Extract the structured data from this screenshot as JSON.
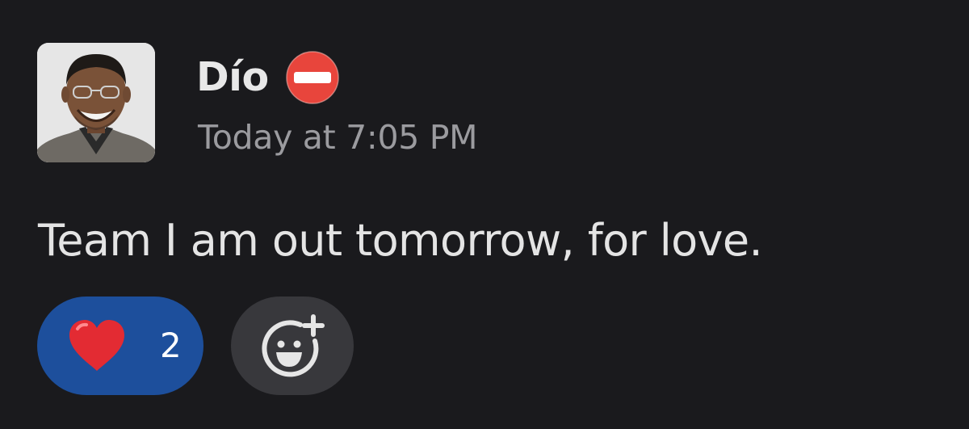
{
  "message": {
    "sender": {
      "name": "Dío",
      "status_icon": "do-not-disturb-icon",
      "avatar": "avatar"
    },
    "timestamp": "Today at 7:05 PM",
    "text": "Team I am out tomorrow, for love."
  },
  "reactions": [
    {
      "emoji": "red-heart-icon",
      "count": "2"
    }
  ],
  "add_reaction": {
    "icon": "add-reaction-icon"
  },
  "colors": {
    "background": "#1a1a1d",
    "reaction_selected": "#1d4f9c",
    "add_reaction_bg": "#38383c",
    "status_red": "#e8453c"
  }
}
